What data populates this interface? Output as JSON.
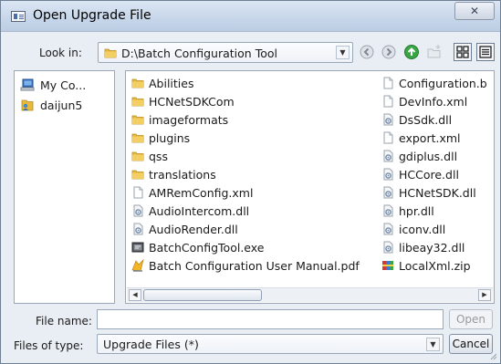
{
  "window": {
    "title": "Open Upgrade File",
    "close_label": "✕"
  },
  "lookin": {
    "label": "Look in:",
    "path": "D:\\Batch Configuration Tool"
  },
  "sidebar": {
    "items": [
      {
        "label": "My Co...",
        "icon": "computer-icon"
      },
      {
        "label": "daijun5",
        "icon": "user-folder-icon"
      }
    ]
  },
  "files": {
    "column1": [
      {
        "name": "Abilities",
        "icon": "folder-icon"
      },
      {
        "name": "HCNetSDKCom",
        "icon": "folder-icon"
      },
      {
        "name": "imageformats",
        "icon": "folder-icon"
      },
      {
        "name": "plugins",
        "icon": "folder-icon"
      },
      {
        "name": "qss",
        "icon": "folder-icon"
      },
      {
        "name": "translations",
        "icon": "folder-icon"
      },
      {
        "name": "AMRemConfig.xml",
        "icon": "document-icon"
      },
      {
        "name": "AudioIntercom.dll",
        "icon": "dll-icon"
      },
      {
        "name": "AudioRender.dll",
        "icon": "dll-icon"
      },
      {
        "name": "BatchConfigTool.exe",
        "icon": "exe-icon"
      },
      {
        "name": "Batch Configuration User Manual.pdf",
        "icon": "pdf-icon"
      }
    ],
    "column2": [
      {
        "name": "Configuration.b",
        "icon": "document-icon"
      },
      {
        "name": "DevInfo.xml",
        "icon": "document-icon"
      },
      {
        "name": "DsSdk.dll",
        "icon": "dll-icon"
      },
      {
        "name": "export.xml",
        "icon": "document-icon"
      },
      {
        "name": "gdiplus.dll",
        "icon": "dll-icon"
      },
      {
        "name": "HCCore.dll",
        "icon": "dll-icon"
      },
      {
        "name": "HCNetSDK.dll",
        "icon": "dll-icon"
      },
      {
        "name": "hpr.dll",
        "icon": "dll-icon"
      },
      {
        "name": "iconv.dll",
        "icon": "dll-icon"
      },
      {
        "name": "libeay32.dll",
        "icon": "dll-icon"
      },
      {
        "name": "LocalXml.zip",
        "icon": "zip-icon"
      }
    ]
  },
  "filename": {
    "label": "File name:",
    "value": "",
    "open_label": "Open"
  },
  "filetype": {
    "label": "Files of type:",
    "selected": "Upgrade Files (*)",
    "cancel_label": "Cancel"
  }
}
